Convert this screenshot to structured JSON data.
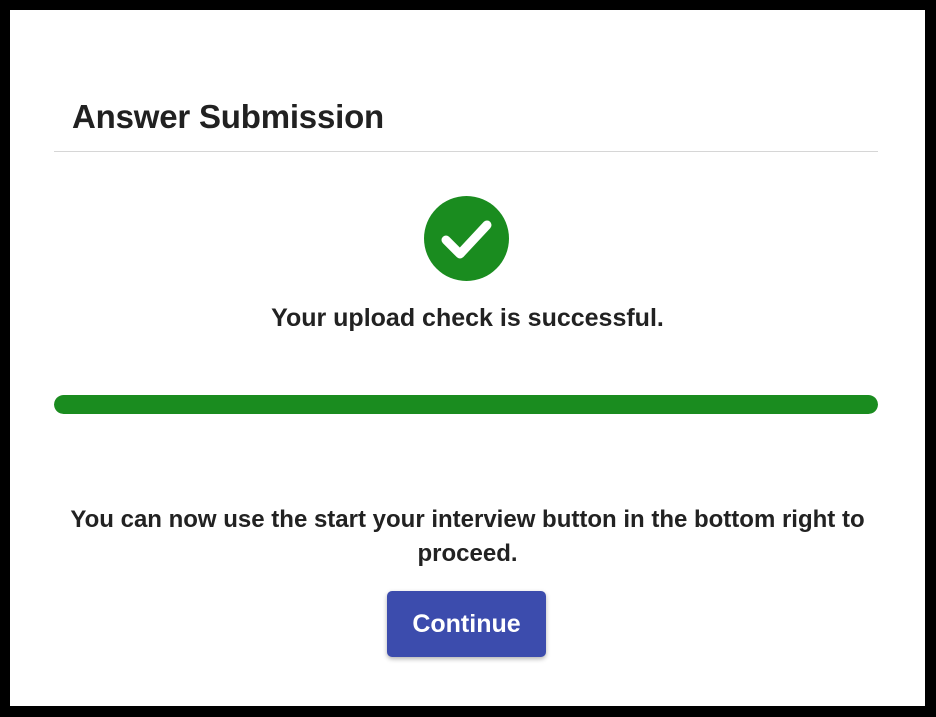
{
  "dialog": {
    "title": "Answer Submission",
    "status_icon": "check-circle-icon",
    "success_message": "Your upload check is successful.",
    "progress_percent": 100,
    "instructions": "You can now use the start your interview button in the bottom right to proceed.",
    "continue_label": "Continue"
  },
  "colors": {
    "success": "#1a8c1f",
    "primary": "#3c4cad",
    "background_frame": "#000000"
  }
}
